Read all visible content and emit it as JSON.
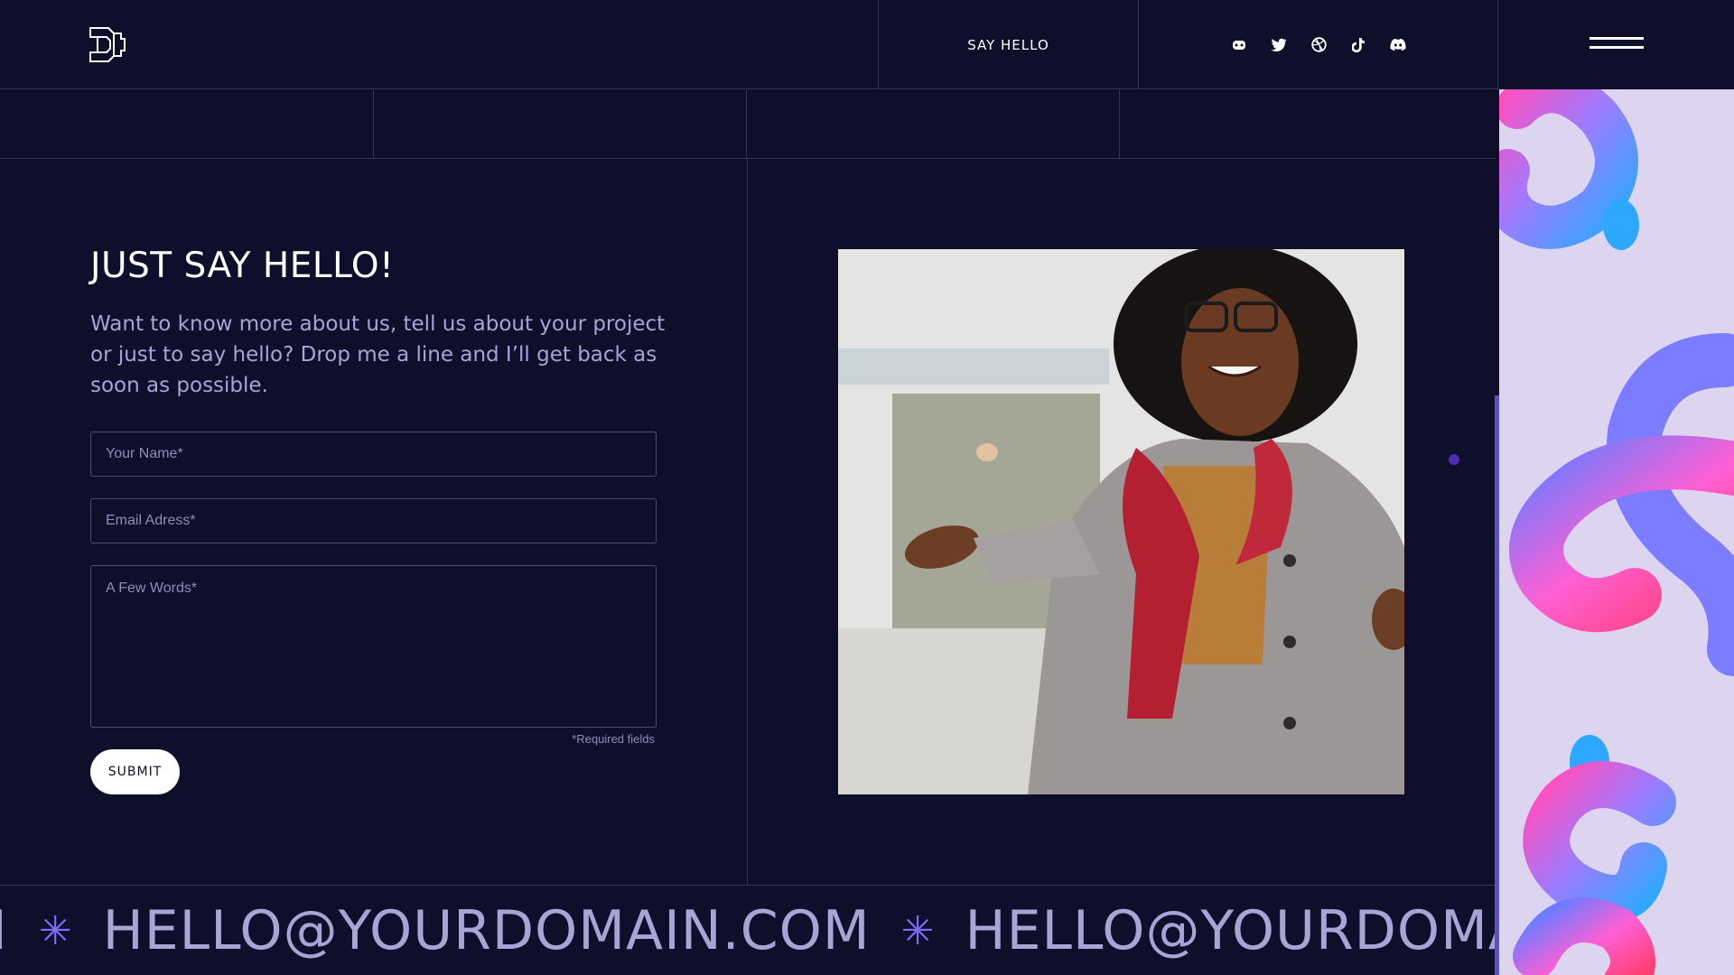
{
  "header": {
    "say_hello": "SAY HELLO",
    "social_icons": [
      "gamepad-icon",
      "twitter-icon",
      "dribbble-icon",
      "tiktok-icon",
      "discord-icon"
    ],
    "menu_icon": "hamburger-icon"
  },
  "contact": {
    "title": "JUST SAY HELLO!",
    "intro": "Want to know more about us, tell us about your project or just to say hello? Drop me a line and I’ll get back as soon as possible.",
    "name_placeholder": "Your Name*",
    "email_placeholder": "Email Adress*",
    "message_placeholder": "A Few Words*",
    "required_note": "*Required fields",
    "submit_label": "SUBMIT"
  },
  "marquee": {
    "items": [
      "M",
      "HELLO@YOURDOMAIN.COM",
      "HELLO@YOURDOMA"
    ],
    "separator": "✳"
  },
  "colors": {
    "background": "#0f0f2c",
    "text_muted": "#a7a4d6",
    "accent": "#7b6cff",
    "panel": "#ddd5f0"
  }
}
